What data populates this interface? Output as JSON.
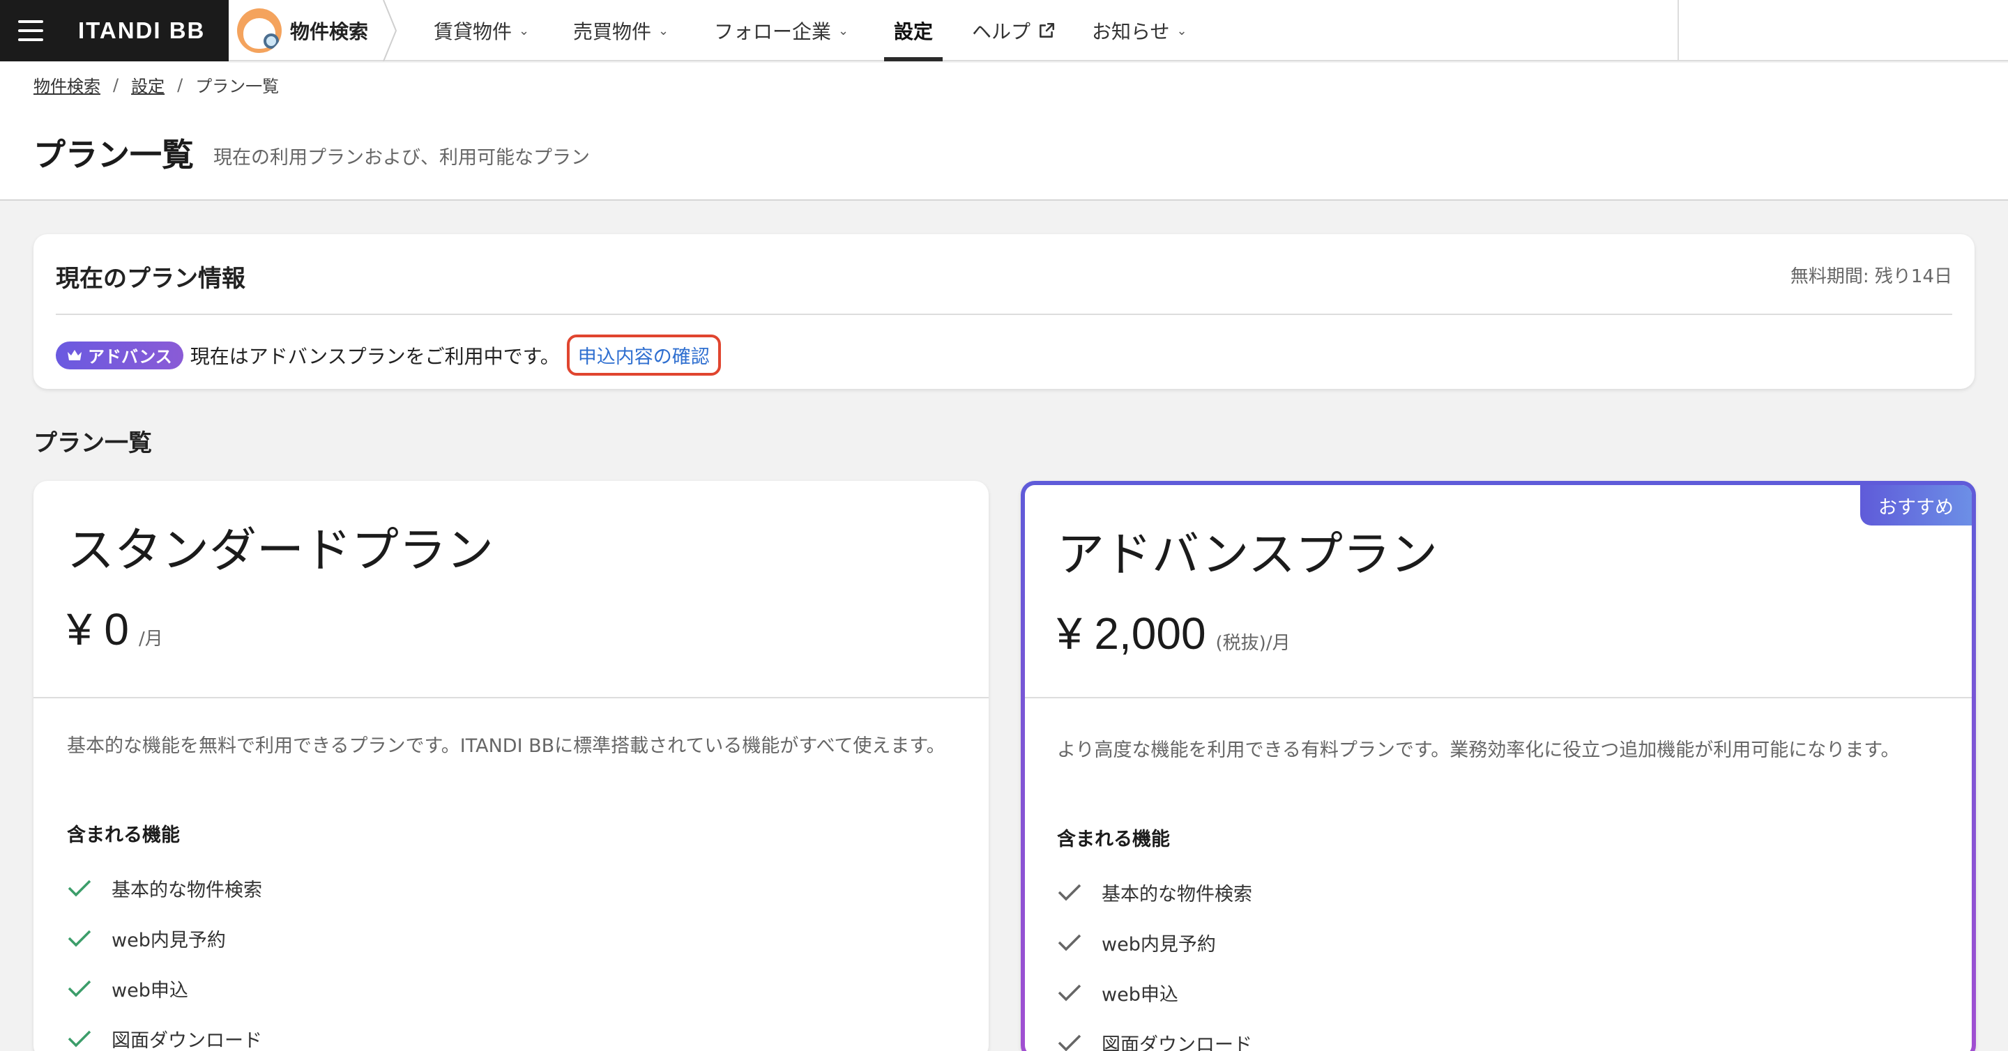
{
  "header": {
    "brand": "ITANDI BB",
    "search_label": "物件検索",
    "nav": [
      {
        "label": "賃貸物件",
        "dropdown": true
      },
      {
        "label": "売買物件",
        "dropdown": true
      },
      {
        "label": "フォロー企業",
        "dropdown": true
      },
      {
        "label": "設定",
        "active": true
      },
      {
        "label": "ヘルプ",
        "external": true
      },
      {
        "label": "お知らせ",
        "dropdown": true
      }
    ]
  },
  "breadcrumb": {
    "items": [
      "物件検索",
      "設定"
    ],
    "current": "プラン一覧",
    "separator": "/"
  },
  "page": {
    "title": "プラン一覧",
    "subtitle": "現在の利用プランおよび、利用可能なプラン"
  },
  "current_plan": {
    "title": "現在のプラン情報",
    "trial": "無料期間: 残り14日",
    "badge": "アドバンス",
    "message": "現在はアドバンスプランをご利用中です。",
    "link": "申込内容の確認"
  },
  "plan_list": {
    "title": "プラン一覧",
    "plans": [
      {
        "name": "スタンダードプラン",
        "price": "¥ 0",
        "unit": "/月",
        "description": "基本的な機能を無料で利用できるプランです。ITANDI BBに標準搭載されている機能がすべて使えます。",
        "features_title": "含まれる機能",
        "features": [
          "基本的な物件検索",
          "web内見予約",
          "web申込",
          "図面ダウンロード"
        ]
      },
      {
        "name": "アドバンスプラン",
        "price": "¥ 2,000",
        "unit": "(税抜)/月",
        "recommended": "おすすめ",
        "description": "より高度な機能を利用できる有料プランです。業務効率化に役立つ追加機能が利用可能になります。",
        "features_title": "含まれる機能",
        "features": [
          "基本的な物件検索",
          "web内見予約",
          "web申込",
          "図面ダウンロード"
        ]
      }
    ]
  },
  "colors": {
    "brand_dark": "#1b1b1b",
    "accent_gradient_start": "#6a5ae0",
    "accent_gradient_end": "#a24fd1",
    "link": "#2f6fd0",
    "highlight_ring": "#e0452f",
    "check_green": "#3c9d6a",
    "check_gray": "#666666"
  }
}
